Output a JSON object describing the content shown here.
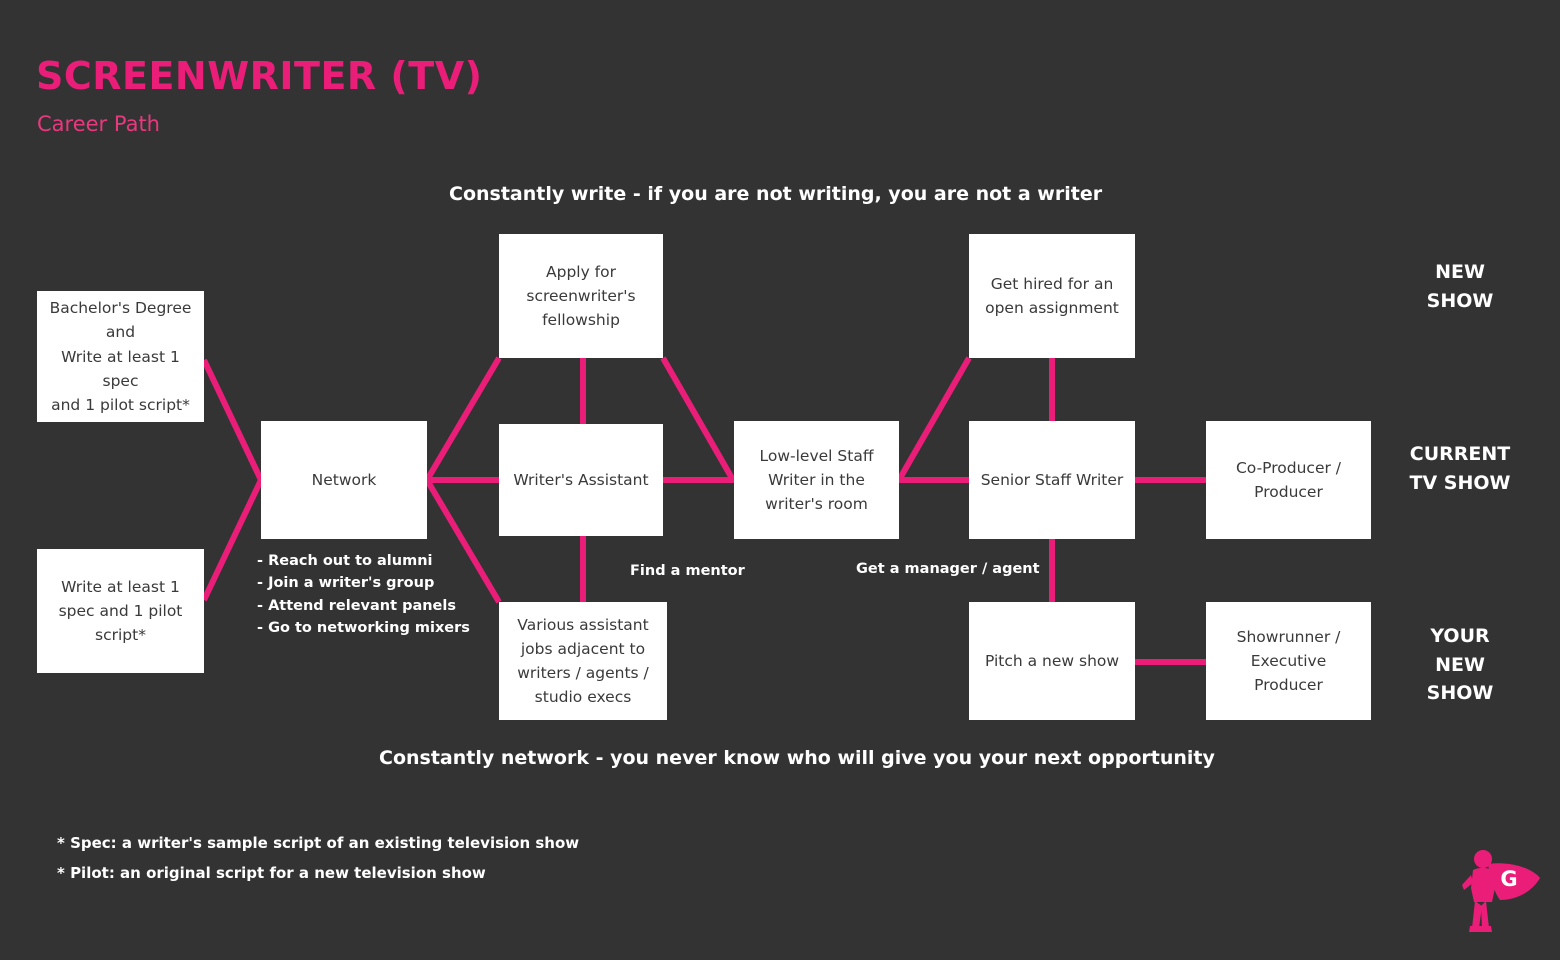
{
  "header": {
    "title": "SCREENWRITER (TV)",
    "subtitle": "Career Path",
    "title_color": "#ea1e79",
    "subtitle_color": "#e8397f"
  },
  "theme": {
    "background": "#333333",
    "accent": "#ea1e79",
    "node_fill": "#ffffff",
    "node_text": "#3a3a3a",
    "banner_text": "#ffffff"
  },
  "banners": {
    "top": "Constantly write - if you are not writing, you are not a writer",
    "bottom": "Constantly network - you never know who will give you your next opportunity"
  },
  "nodes": [
    {
      "id": "bachelors",
      "lines": [
        "Bachelor's Degree",
        "and",
        "Write at least 1 spec",
        "and 1 pilot script*"
      ]
    },
    {
      "id": "spec-pilot",
      "lines": [
        "Write at least 1",
        "spec and 1 pilot",
        "script*"
      ]
    },
    {
      "id": "network",
      "lines": [
        "Network"
      ]
    },
    {
      "id": "fellowship",
      "lines": [
        "Apply for",
        "screenwriter's",
        "fellowship"
      ]
    },
    {
      "id": "writers-assistant",
      "lines": [
        "Writer's Assistant"
      ]
    },
    {
      "id": "various-assistant",
      "lines": [
        "Various assistant",
        "jobs adjacent to",
        "writers / agents /",
        "studio execs"
      ]
    },
    {
      "id": "low-level-staff-writer",
      "lines": [
        "Low-level Staff",
        "Writer in the",
        "writer's room"
      ]
    },
    {
      "id": "open-assignment",
      "lines": [
        "Get hired for an",
        "open assignment"
      ]
    },
    {
      "id": "senior-staff-writer",
      "lines": [
        "Senior Staff Writer"
      ]
    },
    {
      "id": "pitch-new-show",
      "lines": [
        "Pitch a new show"
      ]
    },
    {
      "id": "co-producer",
      "lines": [
        "Co-Producer /",
        "Producer"
      ]
    },
    {
      "id": "showrunner",
      "lines": [
        "Showrunner /",
        "Executive Producer"
      ]
    }
  ],
  "network_tips": [
    "- Reach out to alumni",
    "- Join a writer's group",
    "- Attend relevant panels",
    "- Go to networking mixers"
  ],
  "edge_labels": [
    {
      "id": "find-a-mentor",
      "text": "Find a mentor"
    },
    {
      "id": "get-a-manager-agent",
      "text": "Get a manager / agent"
    }
  ],
  "stage_labels": [
    {
      "id": "new-show",
      "text": "NEW\nSHOW"
    },
    {
      "id": "current-tv-show",
      "text": "CURRENT\nTV SHOW"
    },
    {
      "id": "your-new-show",
      "text": "YOUR\nNEW\nSHOW"
    }
  ],
  "footnotes": [
    "* Spec: a writer's sample script of an existing television show",
    "* Pilot: an original script for a new television show"
  ],
  "logo": {
    "letter": "G",
    "color": "#ea1e79"
  }
}
